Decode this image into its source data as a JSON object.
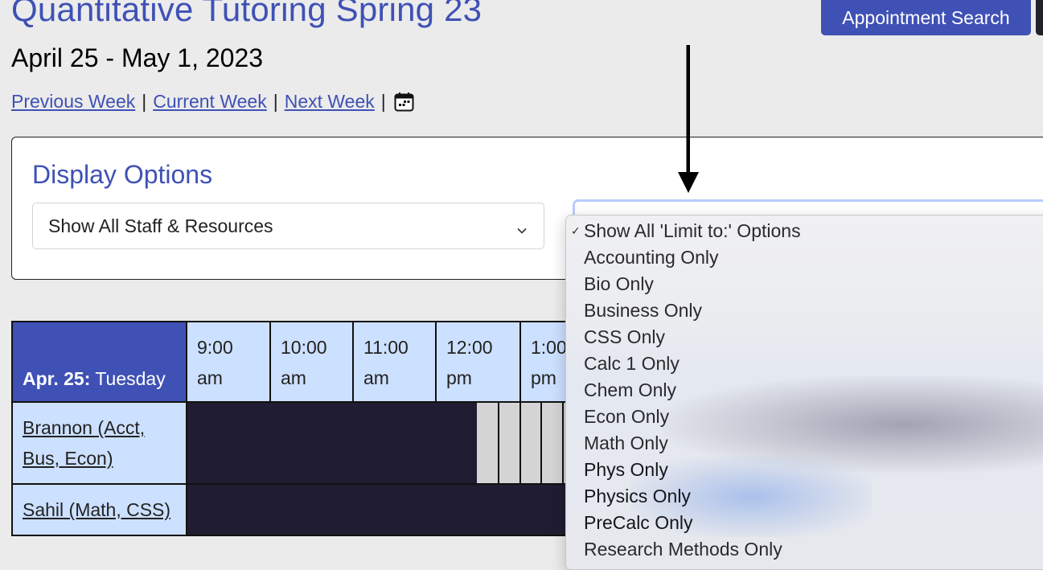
{
  "header": {
    "title": "Quantitative Tutoring Spring 23",
    "appointment_search_label": "Appointment Search",
    "date_range": "April 25 - May 1, 2023"
  },
  "week_nav": {
    "previous": "Previous Week",
    "current": "Current Week",
    "next": "Next Week",
    "separator": "|",
    "calendar_icon": "calendar-icon"
  },
  "display_options": {
    "title": "Display Options",
    "staff_select": {
      "value": "Show All Staff & Resources",
      "icon": "chevron-down-icon"
    },
    "limit_select": {
      "value": "",
      "selected_index": 0,
      "options": [
        "Show All 'Limit to:' Options",
        "Accounting Only",
        "Bio Only",
        "Business Only",
        "CSS Only",
        "Calc 1 Only",
        "Chem Only",
        "Econ Only",
        "Math Only",
        "Phys Only",
        "Physics Only",
        "PreCalc Only",
        "Research Methods Only"
      ]
    }
  },
  "annotation": {
    "arrow_icon": "down-arrow-icon"
  },
  "schedule": {
    "day_label_bold": "Apr. 25:",
    "day_label": "Tuesday",
    "times": [
      {
        "time": "9:00",
        "period": "am"
      },
      {
        "time": "10:00",
        "period": "am"
      },
      {
        "time": "11:00",
        "period": "am"
      },
      {
        "time": "12:00",
        "period": "pm"
      },
      {
        "time": "1:00",
        "period": "pm"
      }
    ],
    "staff": [
      {
        "name": "Brannon (Acct, Bus, Econ)"
      },
      {
        "name": "Sahil (Math, CSS)"
      }
    ]
  },
  "colors": {
    "brand": "#3f51b5",
    "header_cell": "#cce0ff",
    "busy_slot": "#201d32",
    "open_slot": "#d4d4d4",
    "focus_ring": "#b6cdfb"
  }
}
